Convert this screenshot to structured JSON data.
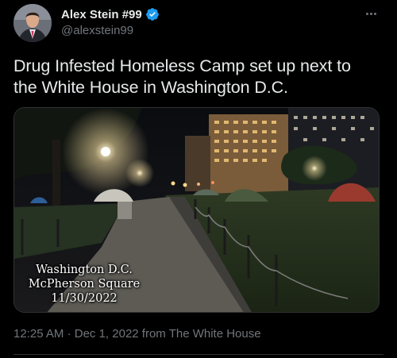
{
  "author": {
    "display_name": "Alex Stein #99",
    "handle": "@alexstein99",
    "verified": true,
    "avatar_icon": "avatar-man-suit-icon"
  },
  "tweet": {
    "text_line1": "Drug Infested Homeless Camp set up next to",
    "text_line2": "the White House in Washington D.C."
  },
  "media": {
    "caption_line1": "Washington D.C.",
    "caption_line2": "McPherson Square",
    "caption_line3": "11/30/2022"
  },
  "meta": {
    "time": "12:25 AM",
    "separator": "·",
    "date": "Dec 1, 2022",
    "from_label": "from",
    "source": "The White House"
  },
  "colors": {
    "background": "#000000",
    "text_primary": "#e7e9ea",
    "text_secondary": "#71767b",
    "verified_blue": "#1d9bf0",
    "border": "#2f3336"
  }
}
